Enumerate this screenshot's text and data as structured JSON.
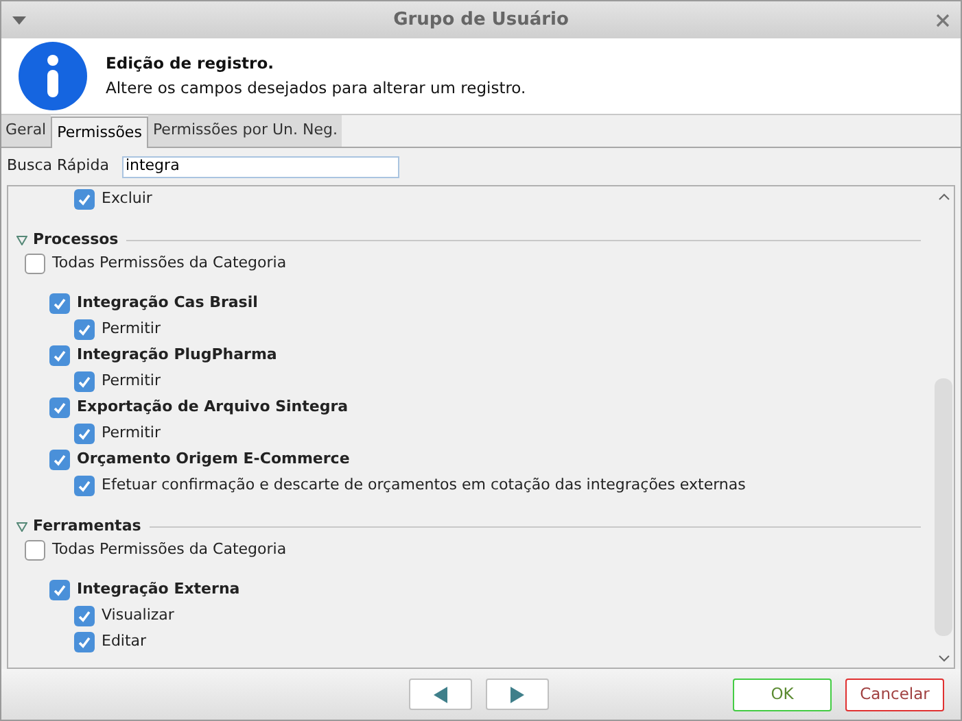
{
  "window": {
    "title": "Grupo de Usuário"
  },
  "header": {
    "title": "Edição de registro.",
    "message": "Altere os campos desejados para alterar um registro."
  },
  "tabs": [
    {
      "label": "Geral",
      "selected": false
    },
    {
      "label": "Permissões",
      "selected": true
    },
    {
      "label": "Permissões por Un. Neg.",
      "selected": false
    }
  ],
  "search": {
    "label": "Busca Rápida",
    "value": "integra"
  },
  "list": {
    "top_items": [
      {
        "label": "Excluir",
        "checked": true
      }
    ],
    "categories": [
      {
        "title": "Processos",
        "expanded": true,
        "all": {
          "label": "Todas Permissões da Categoria",
          "checked": false
        },
        "permissions": [
          {
            "label": "Integração Cas Brasil",
            "checked": true,
            "children": [
              {
                "label": "Permitir",
                "checked": true
              }
            ]
          },
          {
            "label": "Integração PlugPharma",
            "checked": true,
            "children": [
              {
                "label": "Permitir",
                "checked": true
              }
            ]
          },
          {
            "label": "Exportação de Arquivo Sintegra",
            "checked": true,
            "children": [
              {
                "label": "Permitir",
                "checked": true
              }
            ]
          },
          {
            "label": "Orçamento Origem E-Commerce",
            "checked": true,
            "children": [
              {
                "label": "Efetuar confirmação e descarte de orçamentos em cotação das integrações externas",
                "checked": true
              }
            ]
          }
        ]
      },
      {
        "title": "Ferramentas",
        "expanded": true,
        "all": {
          "label": "Todas Permissões da Categoria",
          "checked": false
        },
        "permissions": [
          {
            "label": "Integração Externa",
            "checked": true,
            "children": [
              {
                "label": "Visualizar",
                "checked": true
              },
              {
                "label": "Editar",
                "checked": true
              }
            ]
          }
        ]
      }
    ]
  },
  "buttons": {
    "ok": "OK",
    "cancel": "Cancelar"
  }
}
